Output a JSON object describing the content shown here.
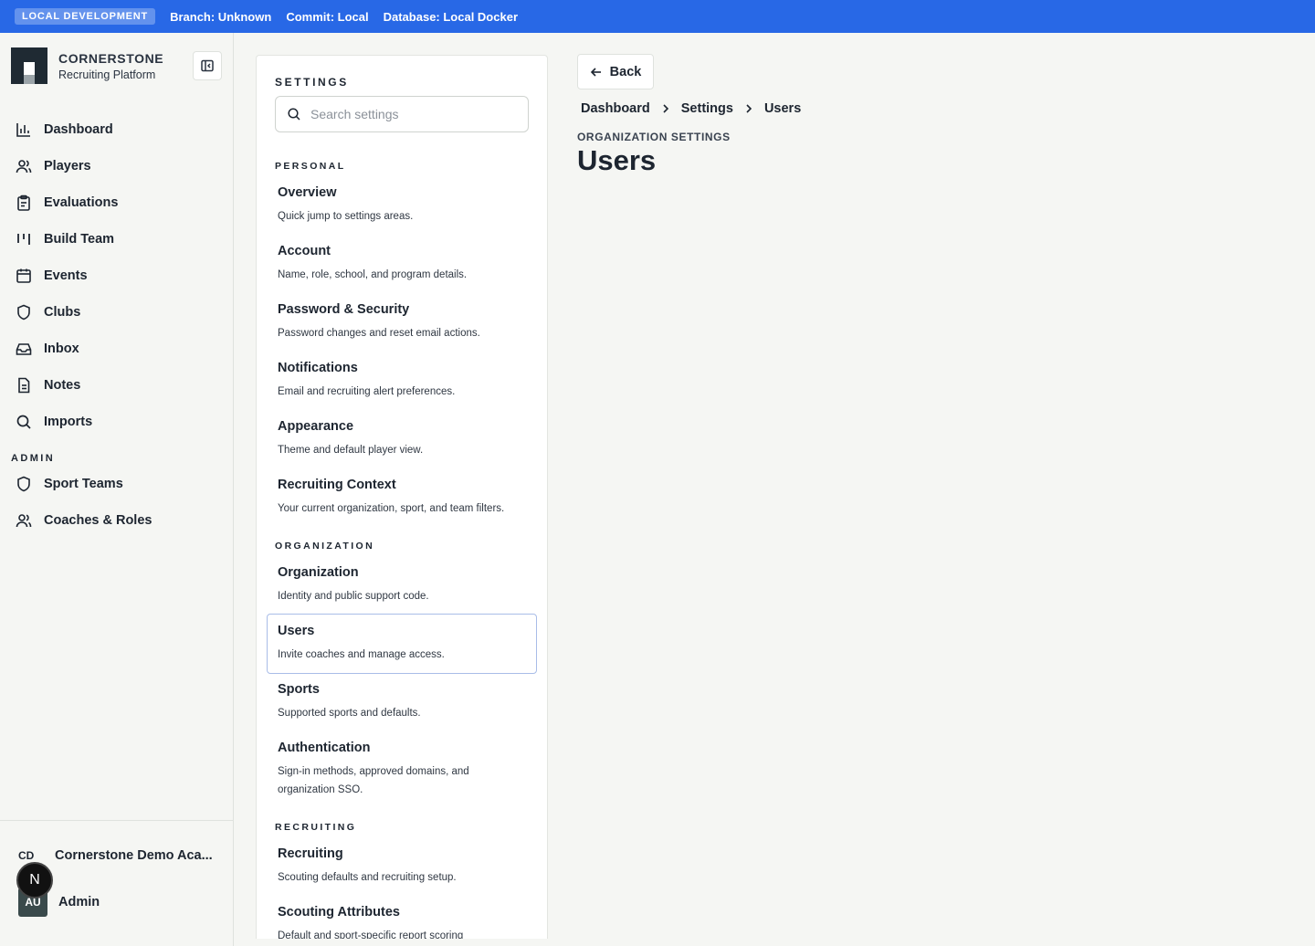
{
  "devbar": {
    "badge": "LOCAL DEVELOPMENT",
    "branch": "Branch: Unknown",
    "commit": "Commit: Local",
    "database": "Database: Local Docker"
  },
  "brand": {
    "title": "CORNERSTONE",
    "subtitle": "Recruiting Platform"
  },
  "nav": {
    "items": [
      {
        "label": "Dashboard",
        "icon": "bar-chart-icon"
      },
      {
        "label": "Players",
        "icon": "users-icon"
      },
      {
        "label": "Evaluations",
        "icon": "clipboard-icon"
      },
      {
        "label": "Build Team",
        "icon": "columns-icon"
      },
      {
        "label": "Events",
        "icon": "calendar-icon"
      },
      {
        "label": "Clubs",
        "icon": "shield-icon"
      },
      {
        "label": "Inbox",
        "icon": "inbox-icon"
      },
      {
        "label": "Notes",
        "icon": "file-icon"
      },
      {
        "label": "Imports",
        "icon": "search-icon"
      }
    ],
    "admin_heading": "ADMIN",
    "admin_items": [
      {
        "label": "Sport Teams",
        "icon": "shield-icon"
      },
      {
        "label": "Coaches & Roles",
        "icon": "users-icon"
      }
    ]
  },
  "footer": {
    "org_abbr": "CD",
    "org_name": "Cornerstone Demo Aca...",
    "user_initials": "AU",
    "user_name": "Admin",
    "badge_letter": "N"
  },
  "settings": {
    "heading": "SETTINGS",
    "search_placeholder": "Search settings",
    "groups": {
      "personal": "PERSONAL",
      "organization": "ORGANIZATION",
      "recruiting": "RECRUITING"
    },
    "items": {
      "overview": {
        "title": "Overview",
        "desc": "Quick jump to settings areas."
      },
      "account": {
        "title": "Account",
        "desc": "Name, role, school, and program details."
      },
      "password": {
        "title": "Password & Security",
        "desc": "Password changes and reset email actions."
      },
      "notifications": {
        "title": "Notifications",
        "desc": "Email and recruiting alert preferences."
      },
      "appearance": {
        "title": "Appearance",
        "desc": "Theme and default player view."
      },
      "context": {
        "title": "Recruiting Context",
        "desc": "Your current organization, sport, and team filters."
      },
      "organization": {
        "title": "Organization",
        "desc": "Identity and public support code."
      },
      "users": {
        "title": "Users",
        "desc": "Invite coaches and manage access."
      },
      "sports": {
        "title": "Sports",
        "desc": "Supported sports and defaults."
      },
      "authentication": {
        "title": "Authentication",
        "desc": "Sign-in methods, approved domains, and organization SSO."
      },
      "recruiting": {
        "title": "Recruiting",
        "desc": "Scouting defaults and recruiting setup."
      },
      "scouting": {
        "title": "Scouting Attributes",
        "desc": "Default and sport-specific report scoring"
      }
    }
  },
  "main": {
    "back_label": "Back",
    "breadcrumb": [
      "Dashboard",
      "Settings",
      "Users"
    ],
    "eyebrow": "ORGANIZATION SETTINGS",
    "title": "Users"
  },
  "colors": {
    "accent": "#2868e6",
    "active_border": "#a9bde8",
    "text": "#1d2530"
  }
}
